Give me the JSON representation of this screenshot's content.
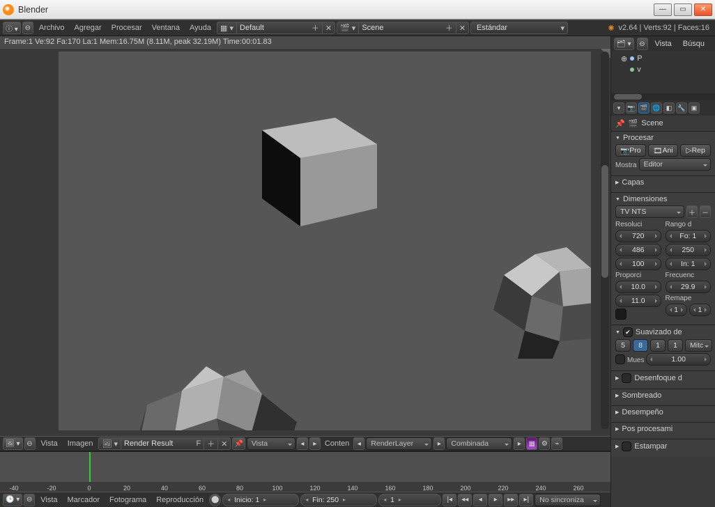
{
  "window": {
    "title": "Blender"
  },
  "header": {
    "menus": [
      "Archivo",
      "Agregar",
      "Procesar",
      "Ventana",
      "Ayuda"
    ],
    "layout": "Default",
    "scene_label": "Scene",
    "shading_label": "Estándar",
    "version_stats": "v2.64 | Verts:92 | Faces:16"
  },
  "status": "Frame:1 Ve:92 Fa:170 La:1 Mem:16.75M (8.11M, peak 32.19M) Time:00:01.83",
  "image_editor": {
    "menus": [
      "Vista",
      "Imagen"
    ],
    "image_name": "Render Result",
    "pin": "F",
    "slot_menu": "Vista",
    "layer_label": "Conten",
    "renderlayer": "RenderLayer",
    "pass": "Combinada"
  },
  "timeline": {
    "menus": [
      "Vista",
      "Marcador",
      "Fotograma",
      "Reproducción"
    ],
    "start_label": "Inicio:",
    "start_value": "1",
    "end_label": "Fin:",
    "end_value": "250",
    "current": "1",
    "sync": "No sincroniza",
    "ticks": [
      -40,
      -20,
      0,
      20,
      40,
      60,
      80,
      100,
      120,
      140,
      160,
      180,
      200,
      220,
      240,
      260
    ]
  },
  "outliner": {
    "menus": [
      "Vista",
      "Búsqu"
    ],
    "items": [
      "P",
      "v"
    ]
  },
  "properties": {
    "crumb_scene": "Scene",
    "panels": {
      "procesar": {
        "title": "Procesar",
        "btn_render": "Pro",
        "btn_anim": "Ani",
        "btn_play": "Rep",
        "display_label": "Mostra",
        "display_value": "Editor"
      },
      "capas": "Capas",
      "dimensiones": {
        "title": "Dimensiones",
        "preset": "TV NTS",
        "res_label": "Resoluci",
        "res_x": "720",
        "res_y": "486",
        "res_pct": "100",
        "range_label": "Rango d",
        "range_start": "Fo: 1",
        "range_end": "250",
        "range_step": "In: 1",
        "aspect_label": "Proporci",
        "aspect_x": "10.0",
        "aspect_y": "11.0",
        "fps_label": "Frecuenc",
        "fps_value": "29.9",
        "remap_label": "Remape",
        "remap_a": "1",
        "remap_b": "1"
      },
      "suavizado": {
        "title": "Suavizado de",
        "samples": [
          "5",
          "8",
          "1",
          "1"
        ],
        "mitchell": "Mitc",
        "mues_label": "Mues",
        "mues_value": "1.00"
      },
      "desenfoque": "Desenfoque d",
      "sombreado": "Sombreado",
      "desempeno": "Desempeño",
      "pospro": "Pos procesami",
      "estampar": "Estampar"
    }
  }
}
